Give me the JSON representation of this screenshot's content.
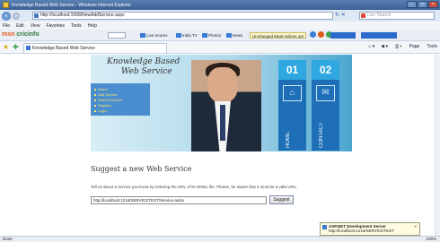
{
  "window": {
    "title": "Knowledge Based Web Service - Windows Internet Explorer",
    "buttons": [
      "–",
      "□",
      "×"
    ]
  },
  "address": {
    "url": "http://localhost:1568/NewAddService.aspx",
    "search_placeholder": "Live Search"
  },
  "menu": [
    "File",
    "Edit",
    "View",
    "Favorites",
    "Tools",
    "Help"
  ],
  "toolbar2": {
    "logo_a": "msn",
    "logo_b": "cricinfo",
    "buttons": [
      "Live Scores",
      "India TV",
      "Photos",
      "News",
      "Unchanged Meat indices opt"
    ]
  },
  "tab": {
    "label": "Knowledge Based Web Service",
    "commands": [
      "Page",
      "Tools"
    ]
  },
  "banner": {
    "title_line1": "Knowledge Based",
    "title_line2": "Web Service",
    "nav_links": [
      "Home",
      "Add Service",
      "Search Service",
      "Register",
      "Login"
    ],
    "tiles": [
      {
        "num": "01",
        "label": "HOME",
        "icon": "⌂"
      },
      {
        "num": "02",
        "label": "CONTACT",
        "icon": "✉"
      }
    ]
  },
  "form": {
    "heading": "Suggest a new Web Service",
    "description": "Tell us about a service you know by entering the URL of its WSDL file. Please, be aware that it must be a valid URL.",
    "url_value": "http://localhost:1216/SERVICETEST/Service.asmx",
    "submit_label": "Suggest"
  },
  "status": {
    "left": "Done",
    "zoom": "100%"
  },
  "toast": {
    "line1": "ASP.NET Development Server",
    "line2": "http://localhost:1216/SERVICETEST"
  }
}
